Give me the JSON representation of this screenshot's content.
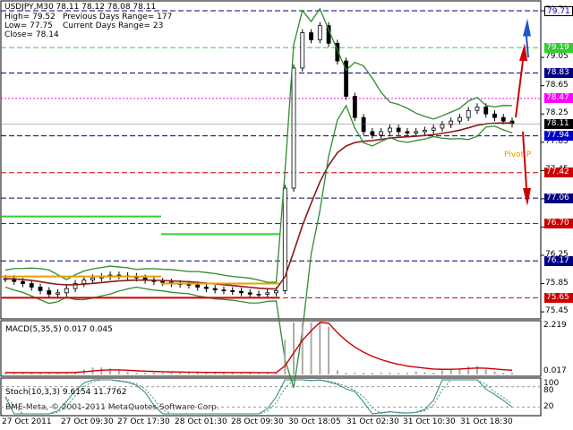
{
  "header": {
    "symbol_line": "USDJPY,M30  78.11 78.12 78.08 78.11",
    "high": "High= 79.52",
    "low": "Low= 77.75",
    "close": "Close= 78.14",
    "prev_range": "Previous Days Range= 177",
    "curr_range": "Current Days Range= 23"
  },
  "pivot_label": "Pivot P",
  "copyright": "BME-Meta, © 2001-2011 MetaQuotes Software Corp.",
  "macd": {
    "title": "MACD(5,35,5) 0.017 0.045",
    "ticks": [
      "2.219",
      "0.017"
    ]
  },
  "stoch": {
    "title": "Stoch(10,3,3) 9.6154 11.7762",
    "ticks": [
      "100",
      "80",
      "20",
      "0"
    ]
  },
  "chart_data": {
    "type": "candlestick",
    "symbol": "USDJPY",
    "timeframe": "M30",
    "price_ticks": [
      "79.71",
      "79.05",
      "78.65",
      "78.25",
      "77.85",
      "77.45",
      "77.05",
      "76.65",
      "76.25",
      "75.85",
      "75.45"
    ],
    "time_labels": [
      "27 Oct 2011",
      "27 Oct 09:30",
      "27 Oct 17:30",
      "28 Oct 01:30",
      "28 Oct 09:30",
      "30 Oct 18:05",
      "31 Oct 02:30",
      "31 Oct 10:30",
      "31 Oct 18:30"
    ],
    "levels": [
      {
        "value": "79.71",
        "bg": "#ffffff",
        "fg": "#0000cc",
        "line": "#000080",
        "dash": "6,3"
      },
      {
        "value": "79.19",
        "bg": "#33cc33",
        "fg": "#ffffff",
        "line": "#33cc33",
        "dash": "6,3"
      },
      {
        "value": "78.83",
        "bg": "#000080",
        "fg": "#ffffff",
        "line": "#000080",
        "dash": "6,3"
      },
      {
        "value": "78.47",
        "bg": "#ff00ff",
        "fg": "#ffffff",
        "line": "#ff00ff",
        "dash": "2,2"
      },
      {
        "value": "78.11",
        "bg": "#000000",
        "fg": "#ffffff",
        "line": "",
        "dash": ""
      },
      {
        "value": "77.94",
        "bg": "#0000cc",
        "fg": "#ffffff",
        "line": "#000080",
        "dash": "6,3"
      },
      {
        "value": "77.42",
        "bg": "#cc0000",
        "fg": "#ffffff",
        "line": "#cc0000",
        "dash": "6,3"
      },
      {
        "value": "77.06",
        "bg": "#000080",
        "fg": "#ffffff",
        "line": "#000080",
        "dash": "6,3"
      },
      {
        "value": "76.70",
        "bg": "#cc0000",
        "fg": "#ffffff",
        "line": "#cc0000",
        "dash": "6,3"
      },
      {
        "value": "76.17",
        "bg": "#000080",
        "fg": "#ffffff",
        "line": "#000080",
        "dash": "6,3"
      },
      {
        "value": "75.65",
        "bg": "#cc0000",
        "fg": "#ffffff",
        "line": "#cc0000",
        "dash": "6,3"
      }
    ],
    "y_range": [
      75.35,
      79.85
    ],
    "close_series_approx": [
      75.92,
      75.88,
      75.85,
      75.8,
      75.75,
      75.7,
      75.72,
      75.78,
      75.85,
      75.9,
      75.93,
      75.95,
      75.97,
      75.96,
      75.95,
      75.93,
      75.9,
      75.88,
      75.87,
      75.85,
      75.84,
      75.83,
      75.8,
      75.78,
      75.76,
      75.75,
      75.74,
      75.72,
      75.7,
      75.7,
      75.72,
      75.75,
      77.2,
      78.9,
      79.4,
      79.3,
      79.5,
      79.25,
      79.0,
      78.5,
      78.2,
      78.0,
      77.95,
      78.0,
      78.05,
      78.0,
      77.98,
      78.0,
      78.02,
      78.05,
      78.1,
      78.15,
      78.2,
      78.3,
      78.35,
      78.25,
      78.2,
      78.15,
      78.11
    ],
    "colors": {
      "bull": "#ffffff",
      "bear": "#000000",
      "band_green": "#2e8b2e",
      "ma_brown": "#8b1a1a",
      "macd_signal": "#cc0000",
      "stoch_main": "#2e8b57",
      "stoch_signal": "#4682b4"
    }
  }
}
